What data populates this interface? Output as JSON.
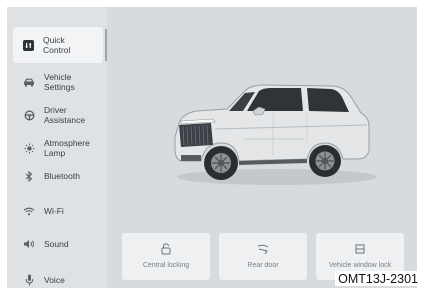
{
  "sidebar": {
    "items": [
      {
        "label": "Quick\nControl",
        "icon": "quick-control-icon",
        "active": true
      },
      {
        "label": "Vehicle\nSettings",
        "icon": "car-icon",
        "active": false
      },
      {
        "label": "Driver\nAssistance",
        "icon": "steering-wheel-icon",
        "active": false
      },
      {
        "label": "Atmosphere\nLamp",
        "icon": "sun-icon",
        "active": false
      },
      {
        "label": "Bluetooth",
        "icon": "bluetooth-icon",
        "active": false
      },
      {
        "label": "Wi-Fi",
        "icon": "wifi-icon",
        "active": false
      },
      {
        "label": "Sound",
        "icon": "speaker-icon",
        "active": false
      },
      {
        "label": "Voice",
        "icon": "microphone-icon",
        "active": false
      }
    ]
  },
  "controls": [
    {
      "label": "Central locking",
      "icon": "lock-icon"
    },
    {
      "label": "Rear door",
      "icon": "tailgate-icon"
    },
    {
      "label": "Vehicle window lock",
      "icon": "window-lock-icon"
    }
  ],
  "footer": {
    "code": "OMT13J-2301"
  },
  "colors": {
    "background": "#d7dbdd",
    "sidebar": "#dfe2e4",
    "active_item": "#f3f4f5",
    "card": "#eef0f1"
  }
}
